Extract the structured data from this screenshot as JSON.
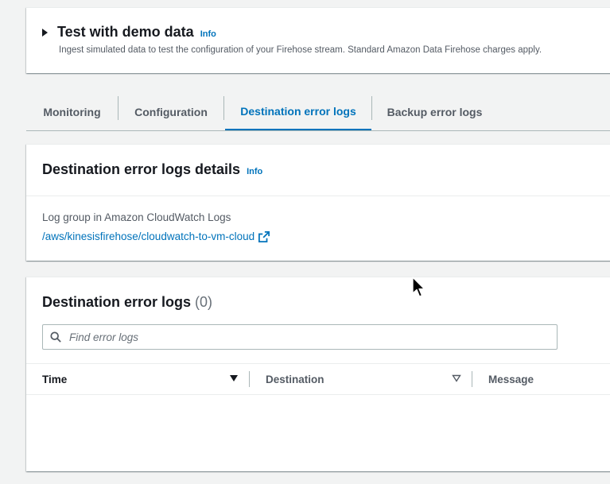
{
  "demo": {
    "title": "Test with demo data",
    "info": "Info",
    "description": "Ingest simulated data to test the configuration of your Firehose stream. Standard Amazon Data Firehose charges apply."
  },
  "tabs": [
    {
      "label": "Monitoring",
      "active": false
    },
    {
      "label": "Configuration",
      "active": false
    },
    {
      "label": "Destination error logs",
      "active": true
    },
    {
      "label": "Backup error logs",
      "active": false
    }
  ],
  "details": {
    "title": "Destination error logs details",
    "info": "Info",
    "log_group_label": "Log group in Amazon CloudWatch Logs",
    "log_group_link": "/aws/kinesisfirehose/cloudwatch-to-vm-cloud"
  },
  "error_logs": {
    "title": "Destination error logs",
    "count": "(0)",
    "search_placeholder": "Find error logs",
    "columns": [
      {
        "label": "Time",
        "sort": "descending"
      },
      {
        "label": "Destination",
        "sort": "unsorted"
      },
      {
        "label": "Message"
      }
    ]
  },
  "colors": {
    "accent": "#0073bb",
    "text": "#16191f",
    "muted": "#545b64",
    "background": "#f2f3f3"
  }
}
